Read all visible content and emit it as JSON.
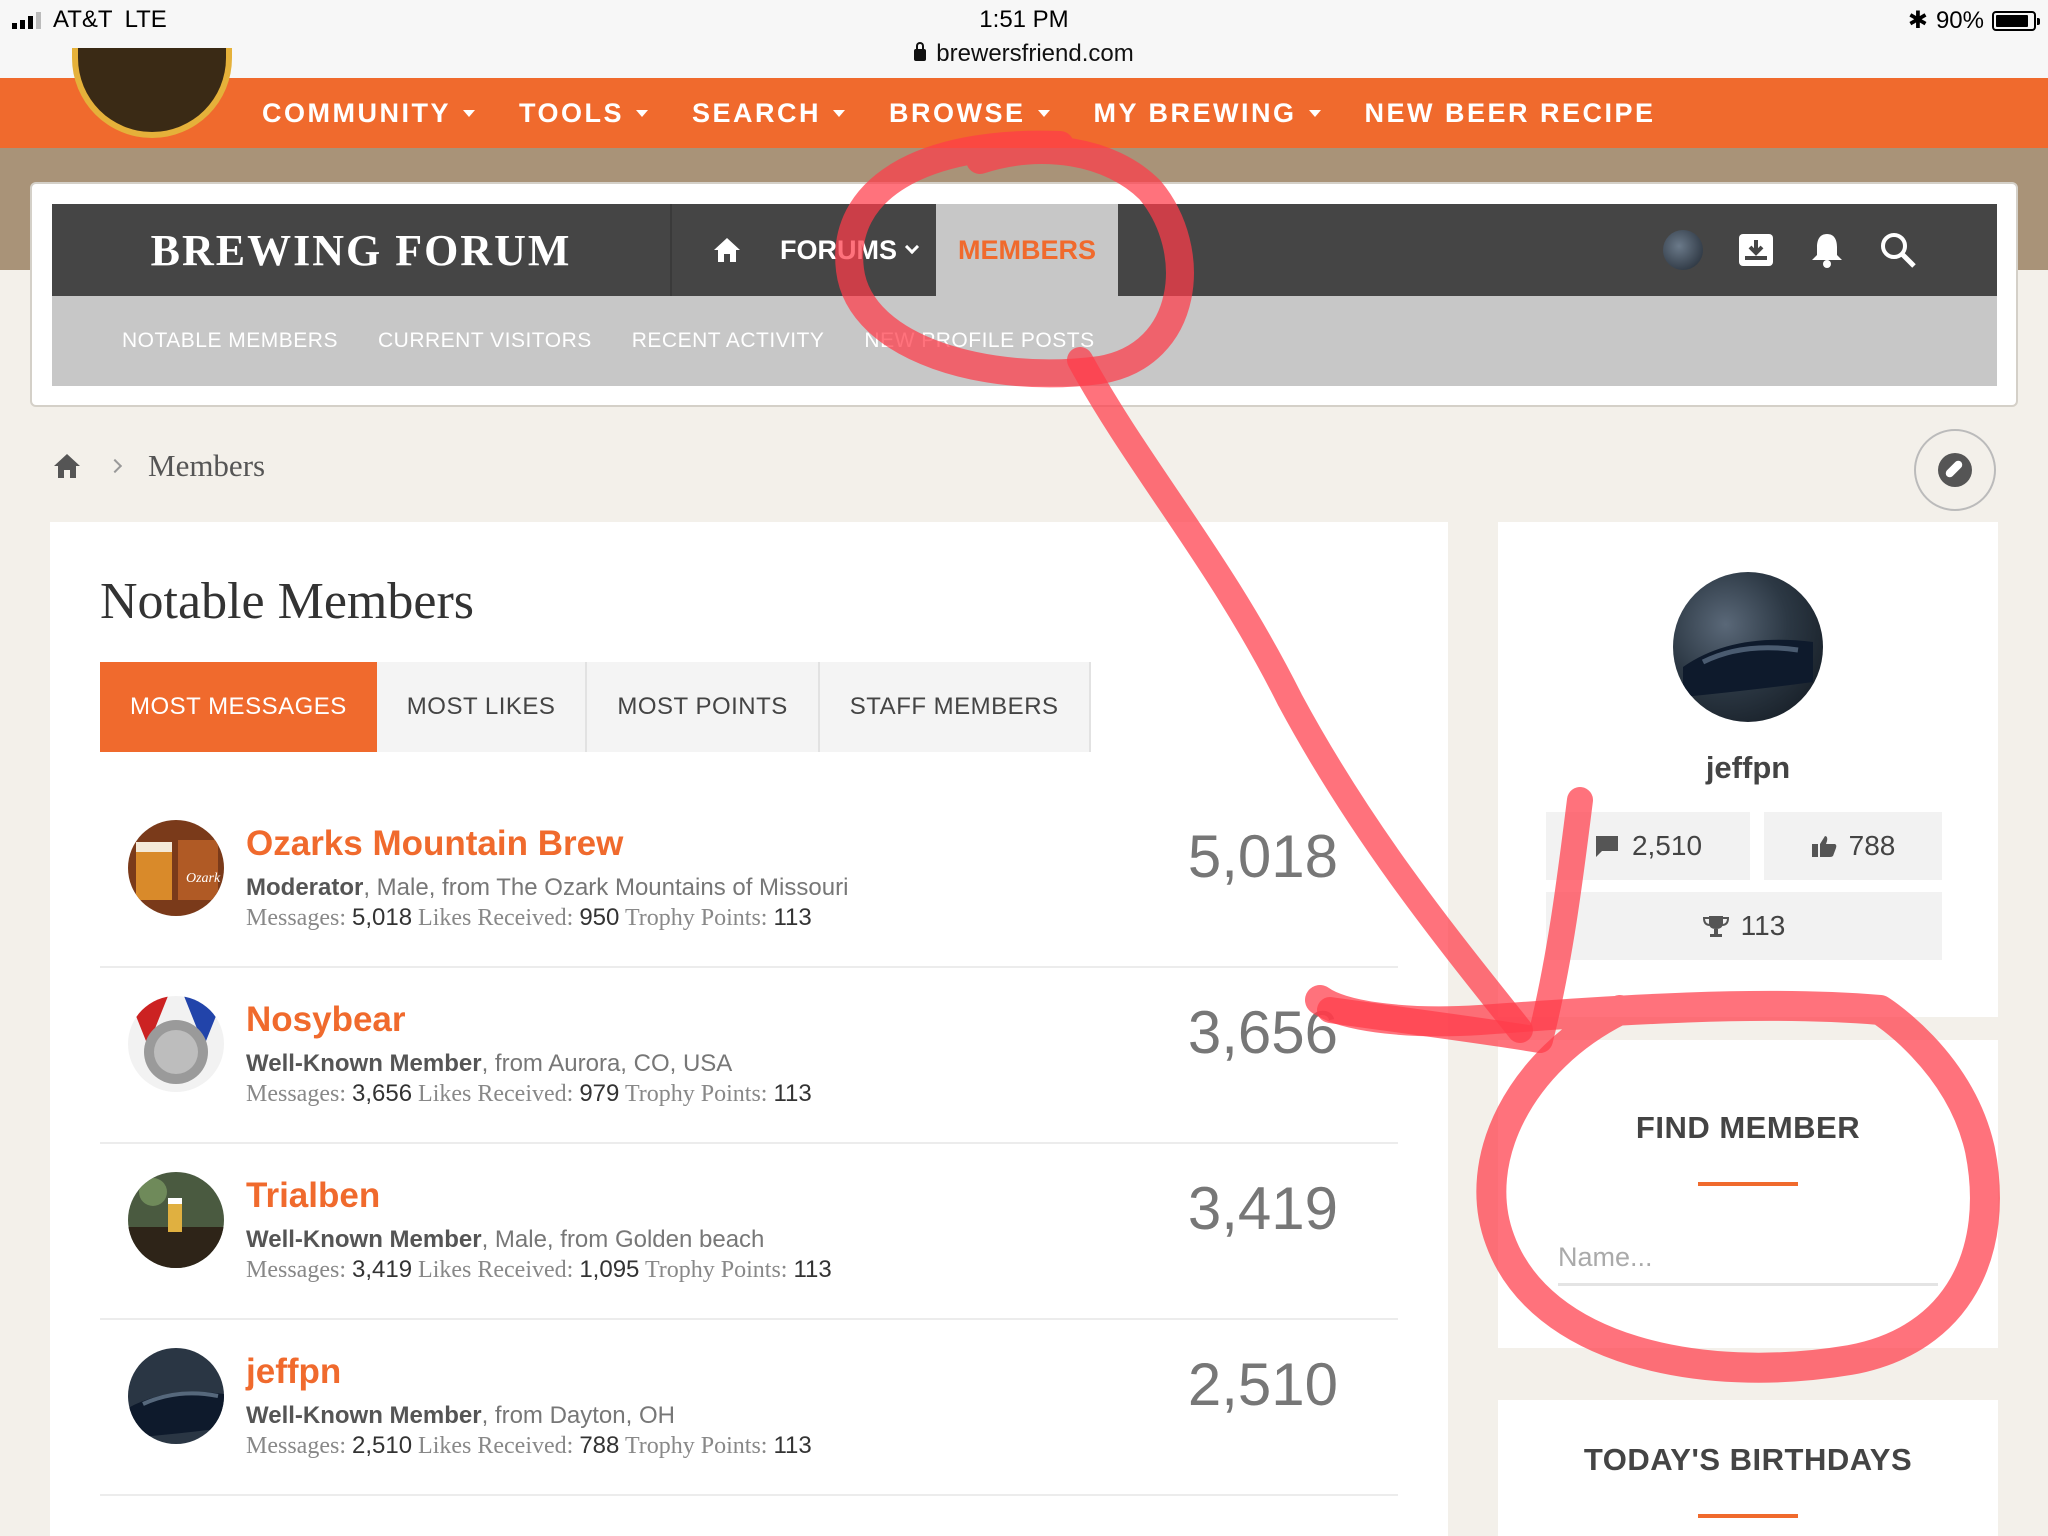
{
  "status_bar": {
    "carrier": "AT&T",
    "network": "LTE",
    "time": "1:51 PM",
    "battery": "90%",
    "battery_level": 0.9,
    "url": "brewersfriend.com"
  },
  "top_nav": {
    "items": [
      "COMMUNITY",
      "TOOLS",
      "SEARCH",
      "BROWSE",
      "MY BREWING",
      "NEW BEER RECIPE"
    ]
  },
  "forum_header": {
    "title": "BREWING FORUM",
    "nav": {
      "forums": "FORUMS",
      "members": "MEMBERS"
    },
    "subnav": [
      "NOTABLE MEMBERS",
      "CURRENT VISITORS",
      "RECENT ACTIVITY",
      "NEW PROFILE POSTS"
    ]
  },
  "breadcrumb": {
    "current": "Members"
  },
  "main": {
    "title": "Notable Members",
    "tabs": [
      "MOST MESSAGES",
      "MOST LIKES",
      "MOST POINTS",
      "STAFF MEMBERS"
    ],
    "active_tab": "MOST MESSAGES",
    "labels": {
      "messages": "Messages:",
      "likes": "Likes Received:",
      "points": "Trophy Points:"
    },
    "members": [
      {
        "name": "Ozarks Mountain Brew",
        "role": "Moderator",
        "details": ", Male, from The Ozark Mountains of Missouri",
        "messages": "5,018",
        "likes": "950",
        "points": "113",
        "count": "5,018"
      },
      {
        "name": "Nosybear",
        "role": "Well-Known Member",
        "details": ", from Aurora, CO, USA",
        "messages": "3,656",
        "likes": "979",
        "points": "113",
        "count": "3,656"
      },
      {
        "name": "Trialben",
        "role": "Well-Known Member",
        "details": ", Male, from Golden beach",
        "messages": "3,419",
        "likes": "1,095",
        "points": "113",
        "count": "3,419"
      },
      {
        "name": "jeffpn",
        "role": "Well-Known Member",
        "details": ", from Dayton, OH",
        "messages": "2,510",
        "likes": "788",
        "points": "113",
        "count": "2,510"
      }
    ]
  },
  "sidebar": {
    "user": {
      "name": "jeffpn",
      "messages": "2,510",
      "likes": "788",
      "points": "113"
    },
    "find_member": {
      "title": "FIND MEMBER",
      "placeholder": "Name..."
    },
    "birthdays": {
      "title": "TODAY'S BIRTHDAYS"
    }
  },
  "colors": {
    "accent": "#f06a2d",
    "dark_bar": "#454545",
    "annotation": "#ff3b4a"
  }
}
